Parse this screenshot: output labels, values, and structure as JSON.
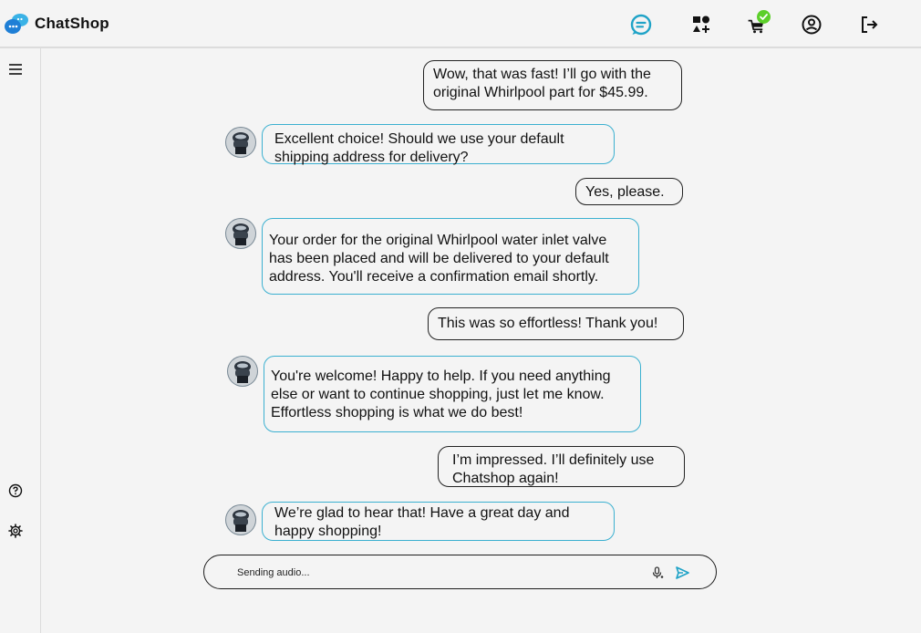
{
  "app": {
    "name": "ChatShop"
  },
  "header": {
    "icons": [
      "chat-icon",
      "categories-add-icon",
      "cart-icon",
      "account-icon",
      "logout-icon"
    ],
    "cart_badge": "check"
  },
  "sidebar": {
    "icons": [
      "menu-icon",
      "help-icon",
      "settings-icon"
    ]
  },
  "messages": [
    {
      "role": "user",
      "text": "Wow, that was fast! I’ll go with the\noriginal Whirlpool part for $45.99."
    },
    {
      "role": "bot",
      "text": "Excellent choice! Should we use your default\nshipping address for delivery?"
    },
    {
      "role": "user",
      "text": "Yes, please."
    },
    {
      "role": "bot",
      "text": "Your order for the original Whirlpool water inlet valve\nhas been placed and will be delivered to your default\naddress. You'll receive a confirmation email shortly."
    },
    {
      "role": "user",
      "text": "This was so effortless! Thank you!"
    },
    {
      "role": "bot",
      "text": "You're welcome! Happy to help. If you need anything\nelse or want to continue shopping, just let me know.\nEffortless shopping is what we do best!"
    },
    {
      "role": "user",
      "text": "I’m impressed. I’ll definitely use\nChatshop again!"
    },
    {
      "role": "bot",
      "text": "We’re glad to hear that! Have a great day and\nhappy shopping!"
    }
  ],
  "composer": {
    "value": "Sending audio..."
  },
  "colors": {
    "accent": "#1fa3c7",
    "bot_border": "#3bb0d0",
    "user_border": "#222222",
    "badge": "#5ccf2a",
    "background": "#f4f4f4"
  }
}
